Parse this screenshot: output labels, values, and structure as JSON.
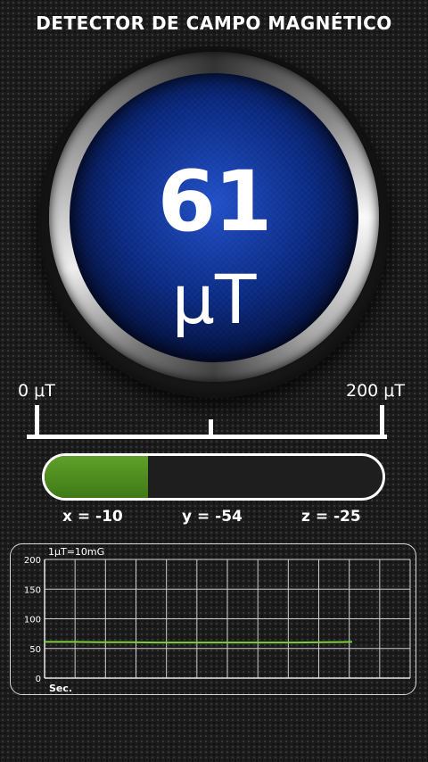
{
  "header": {
    "title": "DETECTOR DE CAMPO MAGNÉTICO"
  },
  "meter": {
    "value": "61",
    "unit": "μT",
    "fraction": 0.305
  },
  "scale": {
    "min_label": "0 μT",
    "max_label": "200 μT"
  },
  "axes": {
    "x": "x = -10",
    "y": "y = -54",
    "z": "z = -25"
  },
  "colors": {
    "accent_green": "#5fa02a",
    "line_green": "#7cd13a",
    "dial_blue": "#0b2a78"
  },
  "graph": {
    "note": "1μT=10mG",
    "xlabel": "Sec."
  },
  "chart_data": {
    "type": "line",
    "title": "",
    "xlabel": "Sec.",
    "ylabel": "",
    "ylim": [
      0,
      200
    ],
    "yticks": [
      0,
      50,
      100,
      150,
      200
    ],
    "grid": true,
    "series": [
      {
        "values": [
          61,
          61,
          60.5,
          60.5,
          60,
          60,
          60,
          60,
          60,
          60,
          60.5,
          61
        ]
      }
    ]
  }
}
